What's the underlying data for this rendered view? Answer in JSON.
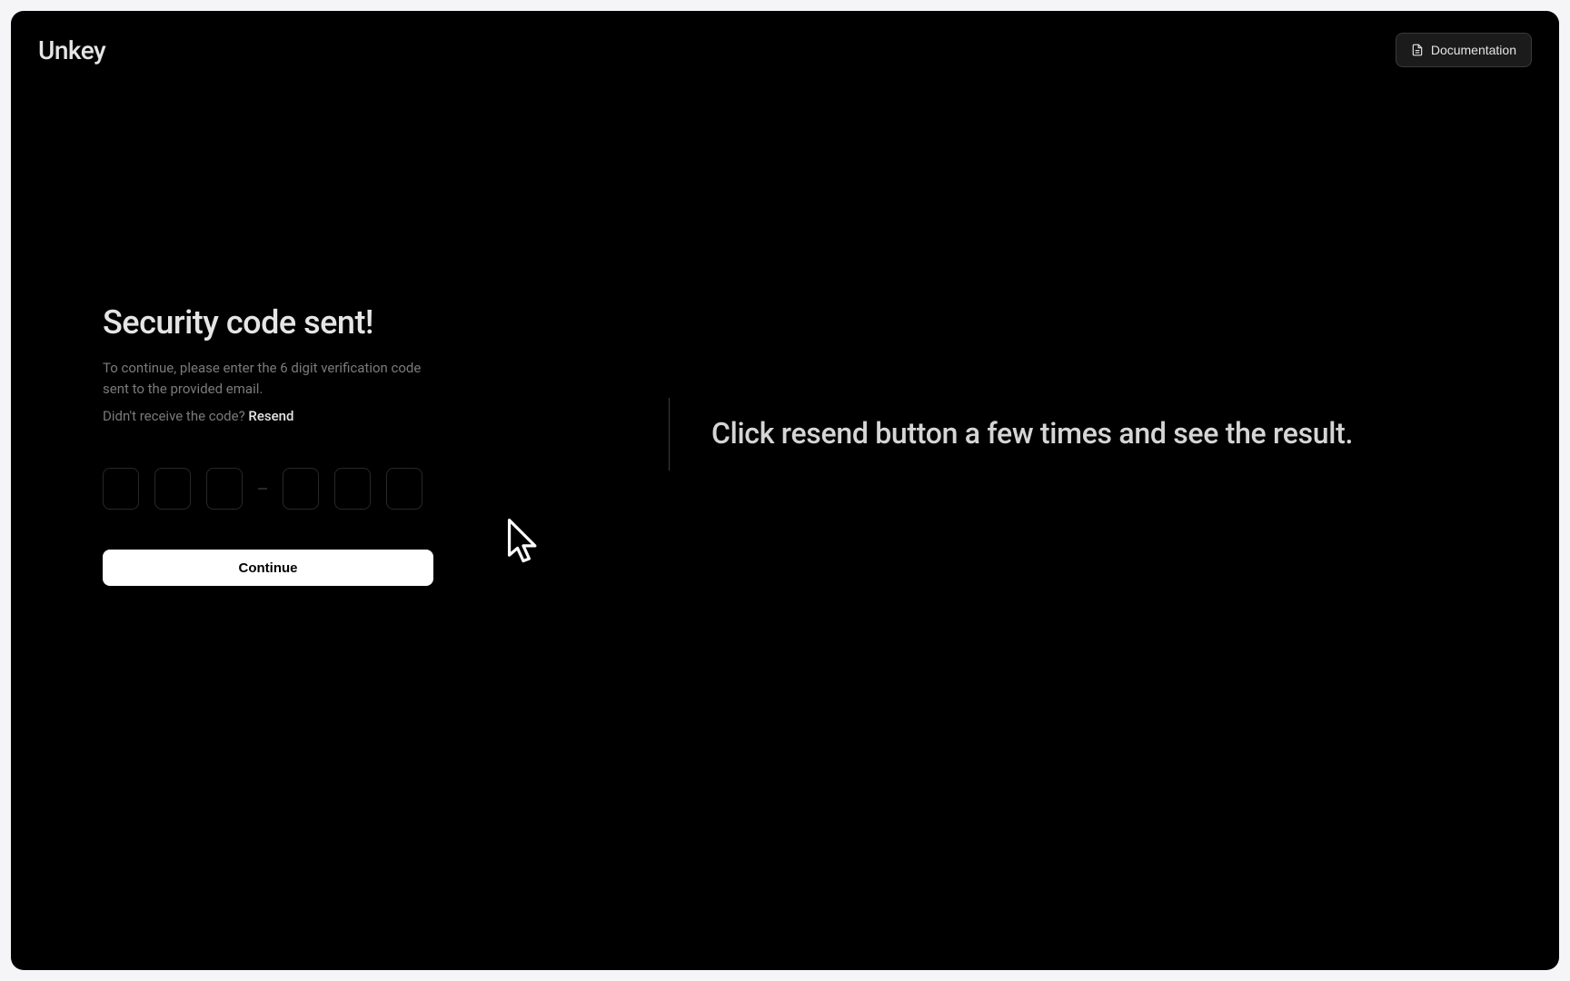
{
  "header": {
    "logo": "Unkey",
    "documentation_label": "Documentation"
  },
  "verification": {
    "heading": "Security code sent!",
    "description": "To continue, please enter the 6 digit verification code sent to the provided email.",
    "resend_prompt": "Didn't receive the code? ",
    "resend_action": "Resend",
    "otp_digits": [
      "",
      "",
      "",
      "",
      "",
      ""
    ],
    "continue_label": "Continue"
  },
  "instruction": {
    "text": "Click resend button a few times and see the result."
  }
}
